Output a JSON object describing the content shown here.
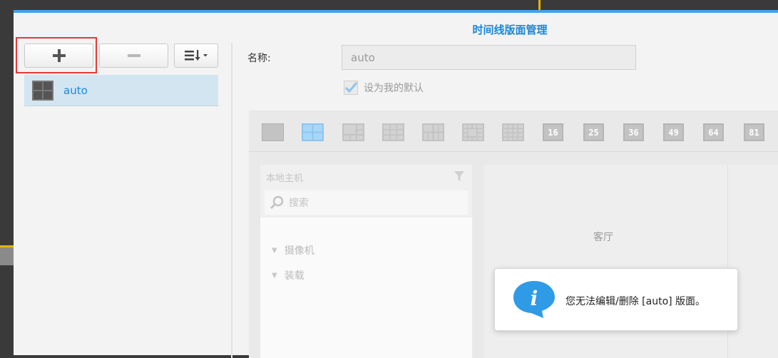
{
  "dialog": {
    "title": "时间线版面管理"
  },
  "toolbar": {
    "add_icon": "plus-icon",
    "remove_icon": "minus-icon",
    "sort_icon": "sort-icon"
  },
  "layouts": [
    {
      "label": "auto",
      "icon": "grid-2x2-icon",
      "selected": true
    }
  ],
  "form": {
    "name_label": "名称:",
    "name_value": "auto",
    "default_label": "设为我的默认",
    "default_checked": true
  },
  "grid_options": [
    "16",
    "25",
    "36",
    "49",
    "64",
    "81"
  ],
  "host_panel": {
    "title": "本地主机",
    "search_placeholder": "搜索",
    "tree": [
      "摄像机",
      "装载"
    ]
  },
  "preview": {
    "room_label": "客厅"
  },
  "toast": {
    "message": "您无法编辑/删除 [auto] 版面。",
    "icon": "info-icon"
  },
  "colors": {
    "accent": "#3da3f2",
    "title": "#1a87d8",
    "selected_bg": "#d3e5f0",
    "highlight": "#e53935"
  }
}
